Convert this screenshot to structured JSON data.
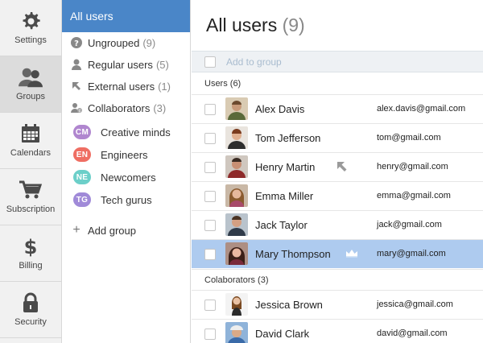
{
  "rail": {
    "items": [
      {
        "label": "Settings",
        "icon": "gear-icon"
      },
      {
        "label": "Groups",
        "icon": "users-icon"
      },
      {
        "label": "Calendars",
        "icon": "calendar-icon"
      },
      {
        "label": "Subscription",
        "icon": "cart-icon"
      },
      {
        "label": "Billing",
        "icon": "dollar-icon"
      },
      {
        "label": "Security",
        "icon": "lock-icon"
      }
    ]
  },
  "groups": {
    "header": "All users",
    "builtin": [
      {
        "label": "Ungrouped",
        "count": "(9)",
        "icon": "question-icon"
      },
      {
        "label": "Regular users",
        "count": "(5)",
        "icon": "person-icon"
      },
      {
        "label": "External users",
        "count": "(1)",
        "icon": "arrow-icon"
      },
      {
        "label": "Collaborators",
        "count": "(3)",
        "icon": "collaborator-icon"
      }
    ],
    "custom": [
      {
        "initials": "CM",
        "label": "Creative minds",
        "color": "#b086cf"
      },
      {
        "initials": "EN",
        "label": "Engineers",
        "color": "#ef6e63"
      },
      {
        "initials": "NE",
        "label": "Newcomers",
        "color": "#6ccfc9"
      },
      {
        "initials": "TG",
        "label": "Tech gurus",
        "color": "#a08ad8"
      }
    ],
    "add_label": "Add group"
  },
  "main": {
    "title": "All users",
    "title_count": "(9)",
    "add_to_group": "Add to group",
    "sections": [
      {
        "label": "Users (6)",
        "users": [
          {
            "name": "Alex Davis",
            "email": "alex.davis@gmail.com",
            "flag": ""
          },
          {
            "name": "Tom Jefferson",
            "email": "tom@gmail.com",
            "flag": ""
          },
          {
            "name": "Henry Martin",
            "email": "henry@gmail.com",
            "flag": "external-arrow-icon"
          },
          {
            "name": "Emma Miller",
            "email": "emma@gmail.com",
            "flag": ""
          },
          {
            "name": "Jack Taylor",
            "email": "jack@gmail.com",
            "flag": ""
          },
          {
            "name": "Mary Thompson",
            "email": "mary@gmail.com",
            "flag": "crown-icon"
          }
        ]
      },
      {
        "label": "Colaborators (3)",
        "users": [
          {
            "name": "Jessica Brown",
            "email": "jessica@gmail.com",
            "flag": ""
          },
          {
            "name": "David Clark",
            "email": "david@gmail.com",
            "flag": ""
          }
        ]
      }
    ],
    "selected_user": "Mary Thompson"
  },
  "colors": {
    "accent": "#4a86c8",
    "selected_row": "#aecbef",
    "toolbar_bg": "#eef1f4"
  }
}
